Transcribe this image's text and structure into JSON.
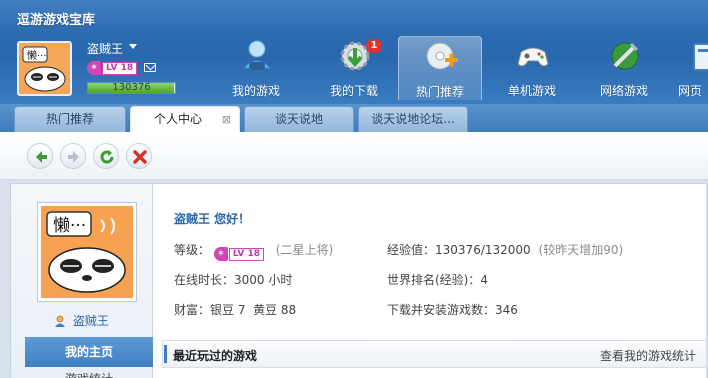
{
  "app": {
    "title": "逗游游戏宝库"
  },
  "user": {
    "name": "盗贼王",
    "level": "LV 18",
    "exp_bar_text": "130376",
    "exp_fraction": 0.988,
    "greeting": "盗贼王 您好！",
    "level_label": "等级：",
    "level_desc": "(二星上将)",
    "online_label": "在线时长：",
    "online_value": "3000 小时",
    "wealth_label": "财富：",
    "wealth_value": "银豆 7  黄豆 88",
    "exp_label": "经验值：",
    "exp_value": "130376/132000",
    "exp_delta": "(较昨天增加90)",
    "rank_label": "世界排名(经验)：",
    "rank_value": "4",
    "downloads_label": "下载并安装游戏数：",
    "downloads_value": "346"
  },
  "nav": {
    "items": [
      {
        "label": "我的游戏",
        "icon": "user-gamepad-icon"
      },
      {
        "label": "我的下载",
        "icon": "gear-download-icon",
        "badge": "1"
      },
      {
        "label": "热门推荐",
        "icon": "disc-plus-icon",
        "active": true
      },
      {
        "label": "单机游戏",
        "icon": "gamepad-icon"
      },
      {
        "label": "网络游戏",
        "icon": "network-game-icon"
      },
      {
        "label": "网页",
        "icon": "web-icon"
      }
    ]
  },
  "tabs": [
    {
      "label": "热门推荐",
      "active": false
    },
    {
      "label": "个人中心",
      "active": true,
      "close": "⊠"
    },
    {
      "label": "谈天说地",
      "active": false
    },
    {
      "label": "谈天说地论坛...",
      "active": false
    }
  ],
  "toolbar": {
    "buttons": [
      "back-icon",
      "forward-icon",
      "refresh-icon",
      "stop-icon"
    ]
  },
  "sidebar": {
    "username": "盗贼王",
    "menu_active": "我的主页",
    "menu_next": "游戏统计"
  },
  "section": {
    "title": "最近玩过的游戏",
    "link": "查看我的游戏统计"
  },
  "colors": {
    "header_blue": "#2d6fb8",
    "accent_blue": "#3f7fc0",
    "level_magenta": "#d046b8",
    "badge_red": "#e5312b",
    "exp_green": "#4ea62d"
  }
}
